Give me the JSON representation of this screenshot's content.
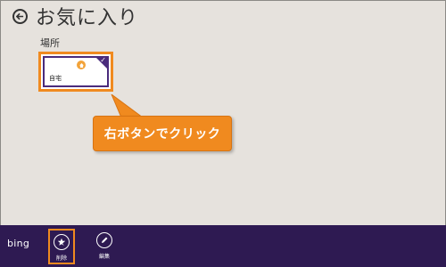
{
  "header": {
    "title": "お気に入り"
  },
  "favorites": {
    "group_label": "場所",
    "tiles": [
      {
        "label": "自宅"
      }
    ]
  },
  "callout": {
    "text": "右ボタンでクリック"
  },
  "appbar": {
    "logo_text": "bing",
    "buttons": [
      {
        "label": "削除",
        "icon": "star-remove-icon"
      },
      {
        "label": "編集",
        "icon": "pencil-icon"
      }
    ]
  },
  "colors": {
    "background": "#e6e2dd",
    "accent": "#4a2b7c",
    "appbar": "#2e1a52",
    "highlight": "#f08a1f"
  }
}
